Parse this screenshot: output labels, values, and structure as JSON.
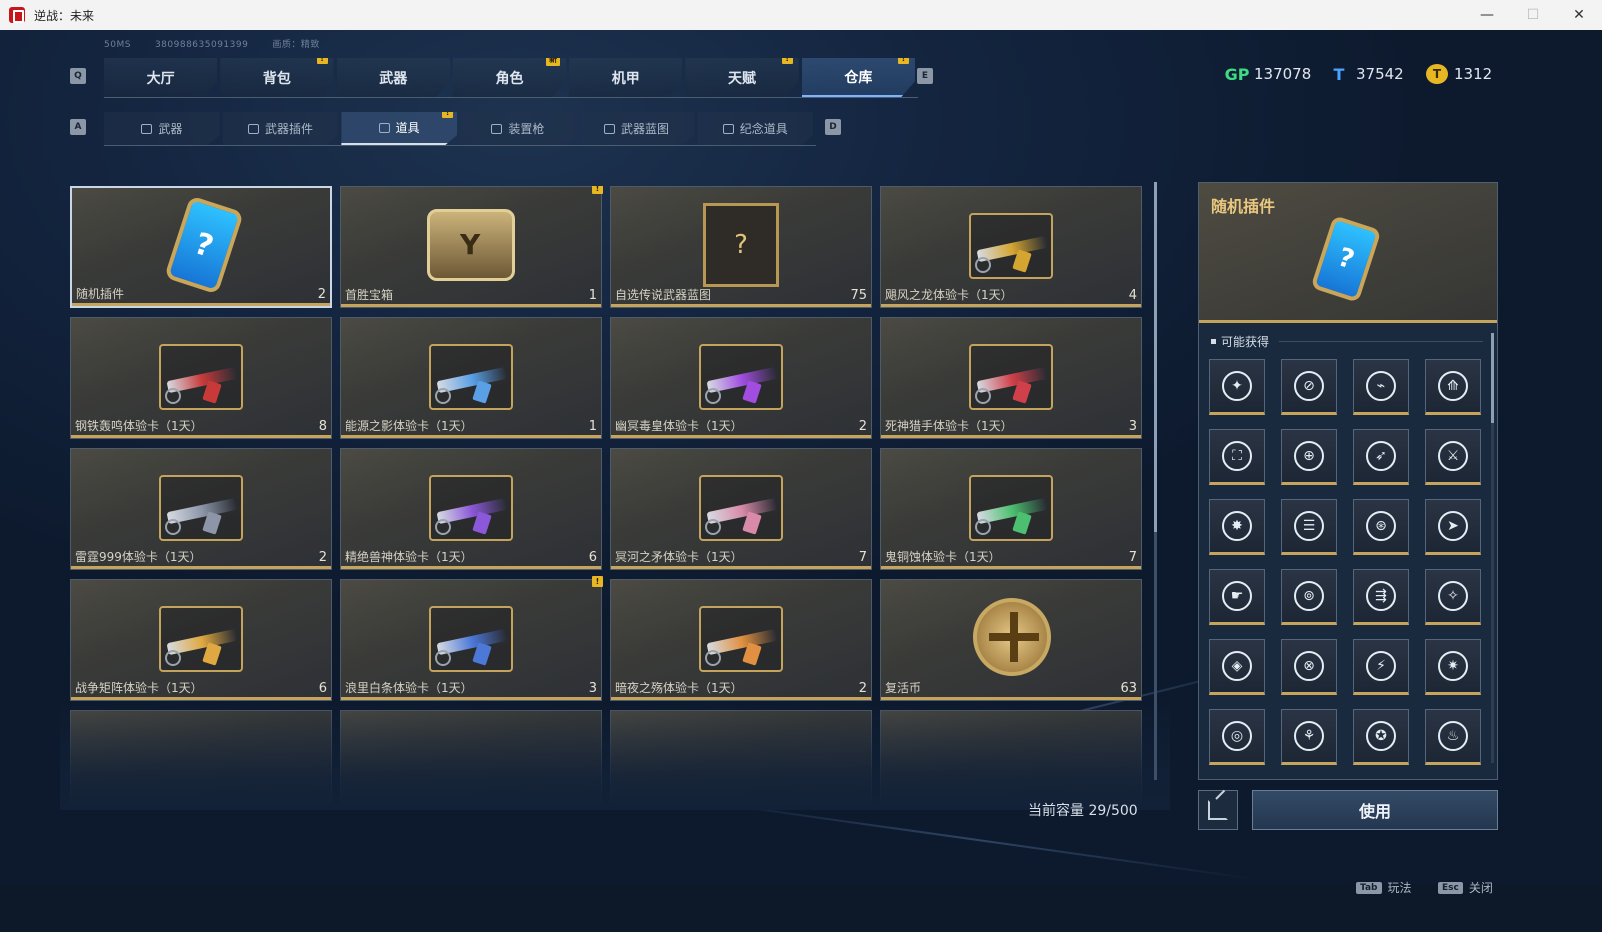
{
  "window": {
    "title": "逆战：未来"
  },
  "status": {
    "ping": "50MS",
    "uid": "380988635091399",
    "quality": "画质：精致"
  },
  "keys": {
    "q": "Q",
    "e": "E",
    "a": "A",
    "d": "D"
  },
  "main_tabs": [
    {
      "label": "大厅",
      "badge": ""
    },
    {
      "label": "背包",
      "badge": "!"
    },
    {
      "label": "武器",
      "badge": ""
    },
    {
      "label": "角色",
      "badge": "新"
    },
    {
      "label": "机甲",
      "badge": ""
    },
    {
      "label": "天赋",
      "badge": "!"
    },
    {
      "label": "仓库",
      "badge": "!",
      "active": true
    }
  ],
  "sub_tabs": [
    {
      "label": "武器",
      "icon": "rifle-icon"
    },
    {
      "label": "武器插件",
      "icon": "plugin-icon"
    },
    {
      "label": "道具",
      "icon": "item-icon",
      "active": true,
      "badge": "!"
    },
    {
      "label": "装置枪",
      "icon": "turret-icon"
    },
    {
      "label": "武器蓝图",
      "icon": "blueprint-icon"
    },
    {
      "label": "纪念道具",
      "icon": "medal-icon"
    }
  ],
  "currencies": [
    {
      "icon": "gp-icon",
      "symbol": "GP",
      "value": "137078",
      "color": "#3ddc84"
    },
    {
      "icon": "ticket-icon",
      "symbol": "T",
      "value": "37542",
      "color": "#4aa3ff"
    },
    {
      "icon": "gold-coin-icon",
      "symbol": "T",
      "value": "1312",
      "color": "#e6b723"
    }
  ],
  "items": [
    {
      "name": "随机插件",
      "count": "2",
      "icon": "plugin-card-icon",
      "selected": true
    },
    {
      "name": "首胜宝箱",
      "count": "1",
      "icon": "treasure-box-icon",
      "badge": "!"
    },
    {
      "name": "自选传说武器蓝图",
      "count": "75",
      "icon": "blueprint-select-icon"
    },
    {
      "name": "飓风之龙体验卡（1天）",
      "count": "4",
      "icon": "gun-trial-icon",
      "color": "#d4a531"
    },
    {
      "name": "钢铁轰鸣体验卡（1天）",
      "count": "8",
      "icon": "gun-trial-icon",
      "color": "#c83a3a"
    },
    {
      "name": "能源之影体验卡（1天）",
      "count": "1",
      "icon": "gun-trial-icon",
      "color": "#5aa0e6"
    },
    {
      "name": "幽冥毒皇体验卡（1天）",
      "count": "2",
      "icon": "gun-trial-icon",
      "color": "#a04de0"
    },
    {
      "name": "死神猎手体验卡（1天）",
      "count": "3",
      "icon": "gun-trial-icon",
      "color": "#d0404a"
    },
    {
      "name": "雷霆999体验卡（1天）",
      "count": "2",
      "icon": "gun-trial-icon",
      "color": "#8c96a8"
    },
    {
      "name": "精绝兽神体验卡（1天）",
      "count": "6",
      "icon": "gun-trial-icon",
      "color": "#8a58d8"
    },
    {
      "name": "冥河之矛体验卡（1天）",
      "count": "7",
      "icon": "gun-trial-icon",
      "color": "#d88aa8"
    },
    {
      "name": "鬼铜蚀体验卡（1天）",
      "count": "7",
      "icon": "gun-trial-icon",
      "color": "#4cc070"
    },
    {
      "name": "战争矩阵体验卡（1天）",
      "count": "6",
      "icon": "gun-trial-icon",
      "color": "#e0a840"
    },
    {
      "name": "浪里白条体验卡（1天）",
      "count": "3",
      "icon": "gun-trial-icon",
      "color": "#4c78d8",
      "badge": "!"
    },
    {
      "name": "暗夜之殇体验卡（1天）",
      "count": "2",
      "icon": "gun-trial-icon",
      "color": "#e09040"
    },
    {
      "name": "复活币",
      "count": "63",
      "icon": "revive-coin-icon"
    }
  ],
  "capacity": "当前容量 29/500",
  "detail": {
    "title": "随机插件",
    "section": "可能获得",
    "glyphs": [
      "✦",
      "⊘",
      "⌁",
      "⟰",
      "⛶",
      "⊕",
      "➶",
      "⚔",
      "✸",
      "☰",
      "⊛",
      "➤",
      "☛",
      "⊚",
      "⇶",
      "✧",
      "◈",
      "⊗",
      "⚡",
      "✷",
      "◎",
      "⚘",
      "✪",
      "♨"
    ],
    "use_label": "使用"
  },
  "hints": [
    {
      "key": "Tab",
      "label": "玩法"
    },
    {
      "key": "Esc",
      "label": "关闭"
    }
  ]
}
